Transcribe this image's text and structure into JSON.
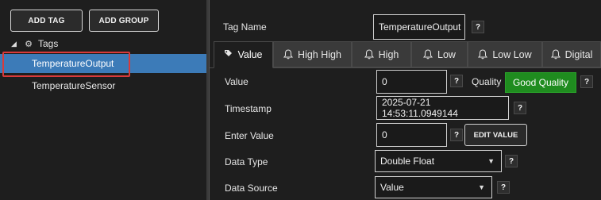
{
  "toolbar": {
    "add_tag_label": "ADD TAG",
    "add_group_label": "ADD GROUP"
  },
  "tree": {
    "root_label": "Tags",
    "items": [
      {
        "label": "TemperatureOutput",
        "selected": true
      },
      {
        "label": "TemperatureSensor",
        "selected": false
      }
    ]
  },
  "details": {
    "tag_name_label": "Tag Name",
    "tag_name_value": "TemperatureOutput",
    "help_glyph": "?",
    "tabs": [
      {
        "label": "Value",
        "icon": "tag-icon",
        "active": true
      },
      {
        "label": "High High",
        "icon": "bell-icon",
        "active": false
      },
      {
        "label": "High",
        "icon": "bell-icon",
        "active": false
      },
      {
        "label": "Low",
        "icon": "bell-icon",
        "active": false
      },
      {
        "label": "Low Low",
        "icon": "bell-icon",
        "active": false
      },
      {
        "label": "Digital",
        "icon": "bell-icon",
        "active": false
      }
    ],
    "value_label": "Value",
    "value": "0",
    "quality_label": "Quality",
    "quality_value": "Good Quality",
    "quality_color": "#1f8c1f",
    "timestamp_label": "Timestamp",
    "timestamp_value": "2025-07-21 14:53:11.0949144",
    "enter_value_label": "Enter Value",
    "enter_value": "0",
    "edit_value_label": "EDIT VALUE",
    "data_type_label": "Data Type",
    "data_type_value": "Double Float",
    "data_source_label": "Data Source",
    "data_source_value": "Value"
  },
  "colors": {
    "selection": "#3c7bb8",
    "highlight_outline": "#d93a3a"
  }
}
